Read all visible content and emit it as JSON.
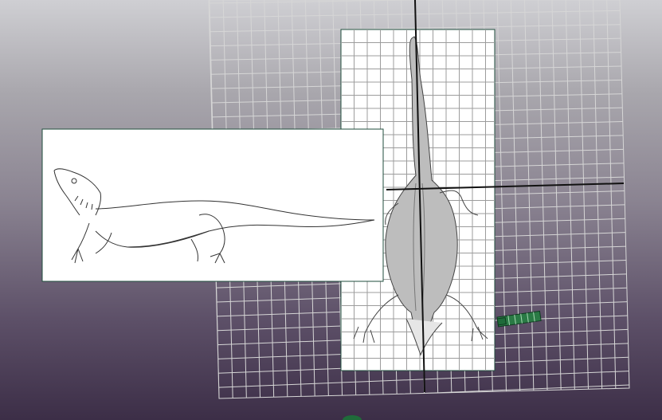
{
  "viewport": {
    "name": "3d-perspective-viewport",
    "background_top": "#cfcfd3",
    "background_bottom": "#3c2e47"
  },
  "colors": {
    "grid_line": "#d6d6d6",
    "axis_line": "#111111",
    "plane_border": "#1f4d3c",
    "image_plane_fill": "#ffffff",
    "camera_icon": "#1f6b3a"
  },
  "objects": {
    "side_image_plane": "side-view-reference-image",
    "top_image_plane": "top-view-reference-image",
    "camera": "camera-icon"
  }
}
